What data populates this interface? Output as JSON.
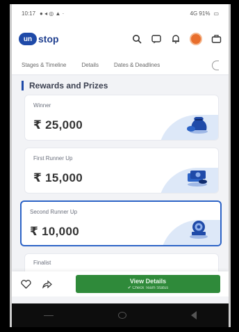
{
  "status_bar": {
    "time": "10:17",
    "right_text": "4G  91%"
  },
  "app": {
    "logo_mark": "un",
    "logo_text": "stop"
  },
  "tabs": [
    {
      "label": "Stages & Timeline"
    },
    {
      "label": "Details"
    },
    {
      "label": "Dates & Deadlines"
    }
  ],
  "section": {
    "title": "Rewards and Prizes"
  },
  "prizes": [
    {
      "label": "Winner",
      "amount": "₹ 25,000",
      "icon": "money-bag-icon"
    },
    {
      "label": "First Runner Up",
      "amount": "₹ 15,000",
      "icon": "cash-stack-icon"
    },
    {
      "label": "Second Runner Up",
      "amount": "₹ 10,000",
      "icon": "medal-icon"
    }
  ],
  "finalist": {
    "label": "Finalist"
  },
  "bottom_bar": {
    "cta_label": "View Details",
    "cta_sublabel": "✔ Check Team Status"
  },
  "colors": {
    "brand": "#1f4aa8",
    "cta": "#2f8a3a",
    "selected_border": "#2c63c6"
  }
}
